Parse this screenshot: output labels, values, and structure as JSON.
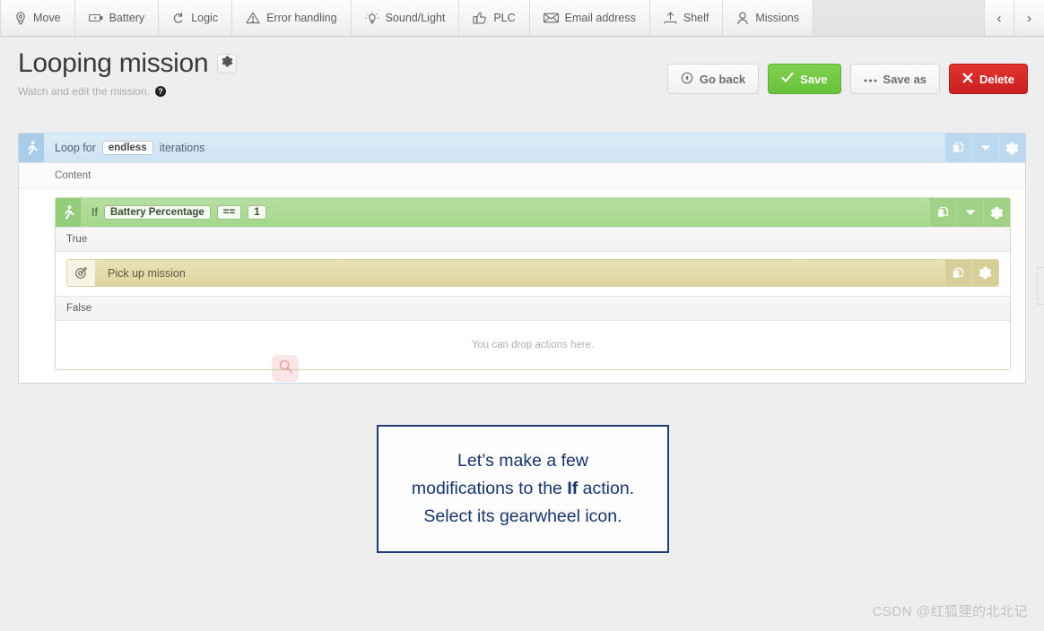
{
  "toolbar": {
    "items": [
      {
        "label": "Move",
        "icon": "move-icon"
      },
      {
        "label": "Battery",
        "icon": "battery-icon"
      },
      {
        "label": "Logic",
        "icon": "logic-loop-icon"
      },
      {
        "label": "Error handling",
        "icon": "warning-triangle-icon"
      },
      {
        "label": "Sound/Light",
        "icon": "lightbulb-icon"
      },
      {
        "label": "PLC",
        "icon": "thumbs-up-icon"
      },
      {
        "label": "Email address",
        "icon": "envelope-icon"
      },
      {
        "label": "Shelf",
        "icon": "upload-shelf-icon"
      },
      {
        "label": "Missions",
        "icon": "person-icon"
      }
    ],
    "prev_label": "‹",
    "next_label": "›"
  },
  "header": {
    "title": "Looping mission",
    "subtitle": "Watch and edit the mission.",
    "help_glyph": "?",
    "gear_icon": "gear-icon"
  },
  "actions": [
    {
      "label": "Go back",
      "icon": "back-circle-icon",
      "style": "light"
    },
    {
      "label": "Save",
      "icon": "check-icon",
      "style": "green"
    },
    {
      "label": "Save as",
      "icon": "ellipsis-icon",
      "style": "light"
    },
    {
      "label": "Delete",
      "icon": "x-icon",
      "style": "red"
    }
  ],
  "builder": {
    "loop": {
      "icon": "running-person-icon",
      "prefix": "Loop for",
      "value": "endless",
      "suffix": "iterations",
      "content_label": "Content",
      "buttons": [
        {
          "name": "copy-icon"
        },
        {
          "name": "chevron-down-icon"
        },
        {
          "name": "gear-icon"
        }
      ]
    },
    "if": {
      "icon": "running-person-icon",
      "keyword": "If",
      "variable": "Battery Percentage",
      "operator": "==",
      "operand": "1",
      "true_label": "True",
      "false_label": "False",
      "buttons": [
        {
          "name": "copy-icon"
        },
        {
          "name": "chevron-down-icon"
        },
        {
          "name": "gear-icon"
        }
      ]
    },
    "action": {
      "icon": "target-arrow-icon",
      "label": "Pick up mission",
      "buttons": [
        {
          "name": "copy-icon"
        },
        {
          "name": "gear-icon"
        }
      ]
    },
    "drop_hint": "You can drop actions here."
  },
  "cursor": {
    "icon": "magnifier-icon",
    "color": "#e65a64"
  },
  "callout": {
    "line1": "Let’s make a few",
    "line2_pre": "modifications to the ",
    "line2_bold": "If",
    "line2_post": " action.",
    "line3": "Select its gearwheel icon."
  },
  "watermark": {
    "text": "CSDN @红狐狸的北北记"
  },
  "colors": {
    "accent_blue": "#a9cce8",
    "accent_green": "#93cd7c",
    "accent_tan": "#ddd5a0",
    "save_green": "#67c13b",
    "delete_red": "#cb1f1f",
    "callout_border": "#1f3e79"
  }
}
